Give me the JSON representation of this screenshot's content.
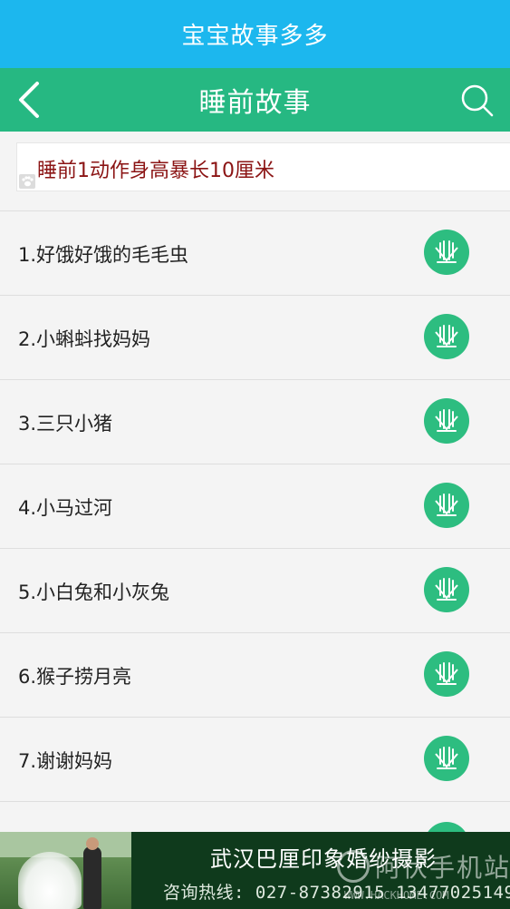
{
  "app": {
    "title": "宝宝故事多多"
  },
  "nav": {
    "title": "睡前故事",
    "back_icon": "chevron-left-icon",
    "search_icon": "search-icon"
  },
  "ad_banner": {
    "text": "睡前1动作身高暴长10厘米",
    "badge_icon": "paw-icon"
  },
  "stories": [
    {
      "title": "1.好饿好饿的毛毛虫"
    },
    {
      "title": "2.小蝌蚪找妈妈"
    },
    {
      "title": "3.三只小猪"
    },
    {
      "title": "4.小马过河"
    },
    {
      "title": "5.小白兔和小灰兔"
    },
    {
      "title": "6.猴子捞月亮"
    },
    {
      "title": "7.谢谢妈妈"
    }
  ],
  "bottom_ad": {
    "studio_name": "武汉巴厘印象婚纱摄影",
    "hotline": "咨询热线: 027-87382915 13477025149"
  },
  "watermark": {
    "text": "阿伏手机站",
    "url": "WWW.HACKHOME.COM"
  },
  "colors": {
    "title_bar": "#1cb7ee",
    "nav_bar": "#26b882",
    "play_button": "#2dbd80",
    "ad_text": "#8b1414"
  }
}
